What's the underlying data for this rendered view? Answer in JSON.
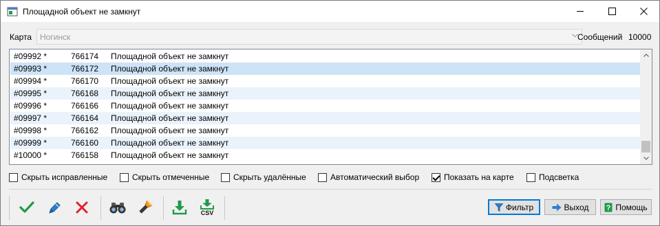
{
  "window": {
    "title": "Площадной объект не замкнут"
  },
  "map": {
    "label": "Карта",
    "value": "Ногинск"
  },
  "messages": {
    "label": "Сообщений",
    "count": "10000"
  },
  "list": {
    "rows": [
      {
        "id": "#09992 *",
        "num": "766174",
        "msg": "Площадной объект не замкнут"
      },
      {
        "id": "#09993 *",
        "num": "766172",
        "msg": "Площадной объект не замкнут"
      },
      {
        "id": "#09994 *",
        "num": "766170",
        "msg": "Площадной объект не замкнут"
      },
      {
        "id": "#09995 *",
        "num": "766168",
        "msg": "Площадной объект не замкнут"
      },
      {
        "id": "#09996 *",
        "num": "766166",
        "msg": "Площадной объект не замкнут"
      },
      {
        "id": "#09997 *",
        "num": "766164",
        "msg": "Площадной объект не замкнут"
      },
      {
        "id": "#09998 *",
        "num": "766162",
        "msg": "Площадной объект не замкнут"
      },
      {
        "id": "#09999 *",
        "num": "766160",
        "msg": "Площадной объект не замкнут"
      },
      {
        "id": "#10000 *",
        "num": "766158",
        "msg": "Площадной объект не замкнут"
      }
    ],
    "selected_index": 1
  },
  "checkboxes": {
    "hide_fixed": {
      "label": "Скрыть исправленные",
      "checked": false
    },
    "hide_marked": {
      "label": "Скрыть отмеченные",
      "checked": false
    },
    "hide_deleted": {
      "label": "Скрыть удалённые",
      "checked": false
    },
    "auto_select": {
      "label": "Автоматический выбор",
      "checked": false
    },
    "show_on_map": {
      "label": "Показать на карте",
      "checked": true
    },
    "highlight": {
      "label": "Подсветка",
      "checked": false
    }
  },
  "toolbar": {
    "icons": [
      "checkmark-icon",
      "pen-icon",
      "x-icon",
      "binoculars-icon",
      "flashlight-icon",
      "download-icon",
      "download-csv-icon"
    ],
    "csv_label": "CSV"
  },
  "buttons": {
    "filter": "Фильтр",
    "exit": "Выход",
    "help": "Помощь"
  },
  "colors": {
    "selected_row": "#cde3f7",
    "alt_row": "#eaf3fb",
    "accent": "#0078d7",
    "ok_green": "#1e9b48",
    "cancel_red": "#e0202a"
  }
}
